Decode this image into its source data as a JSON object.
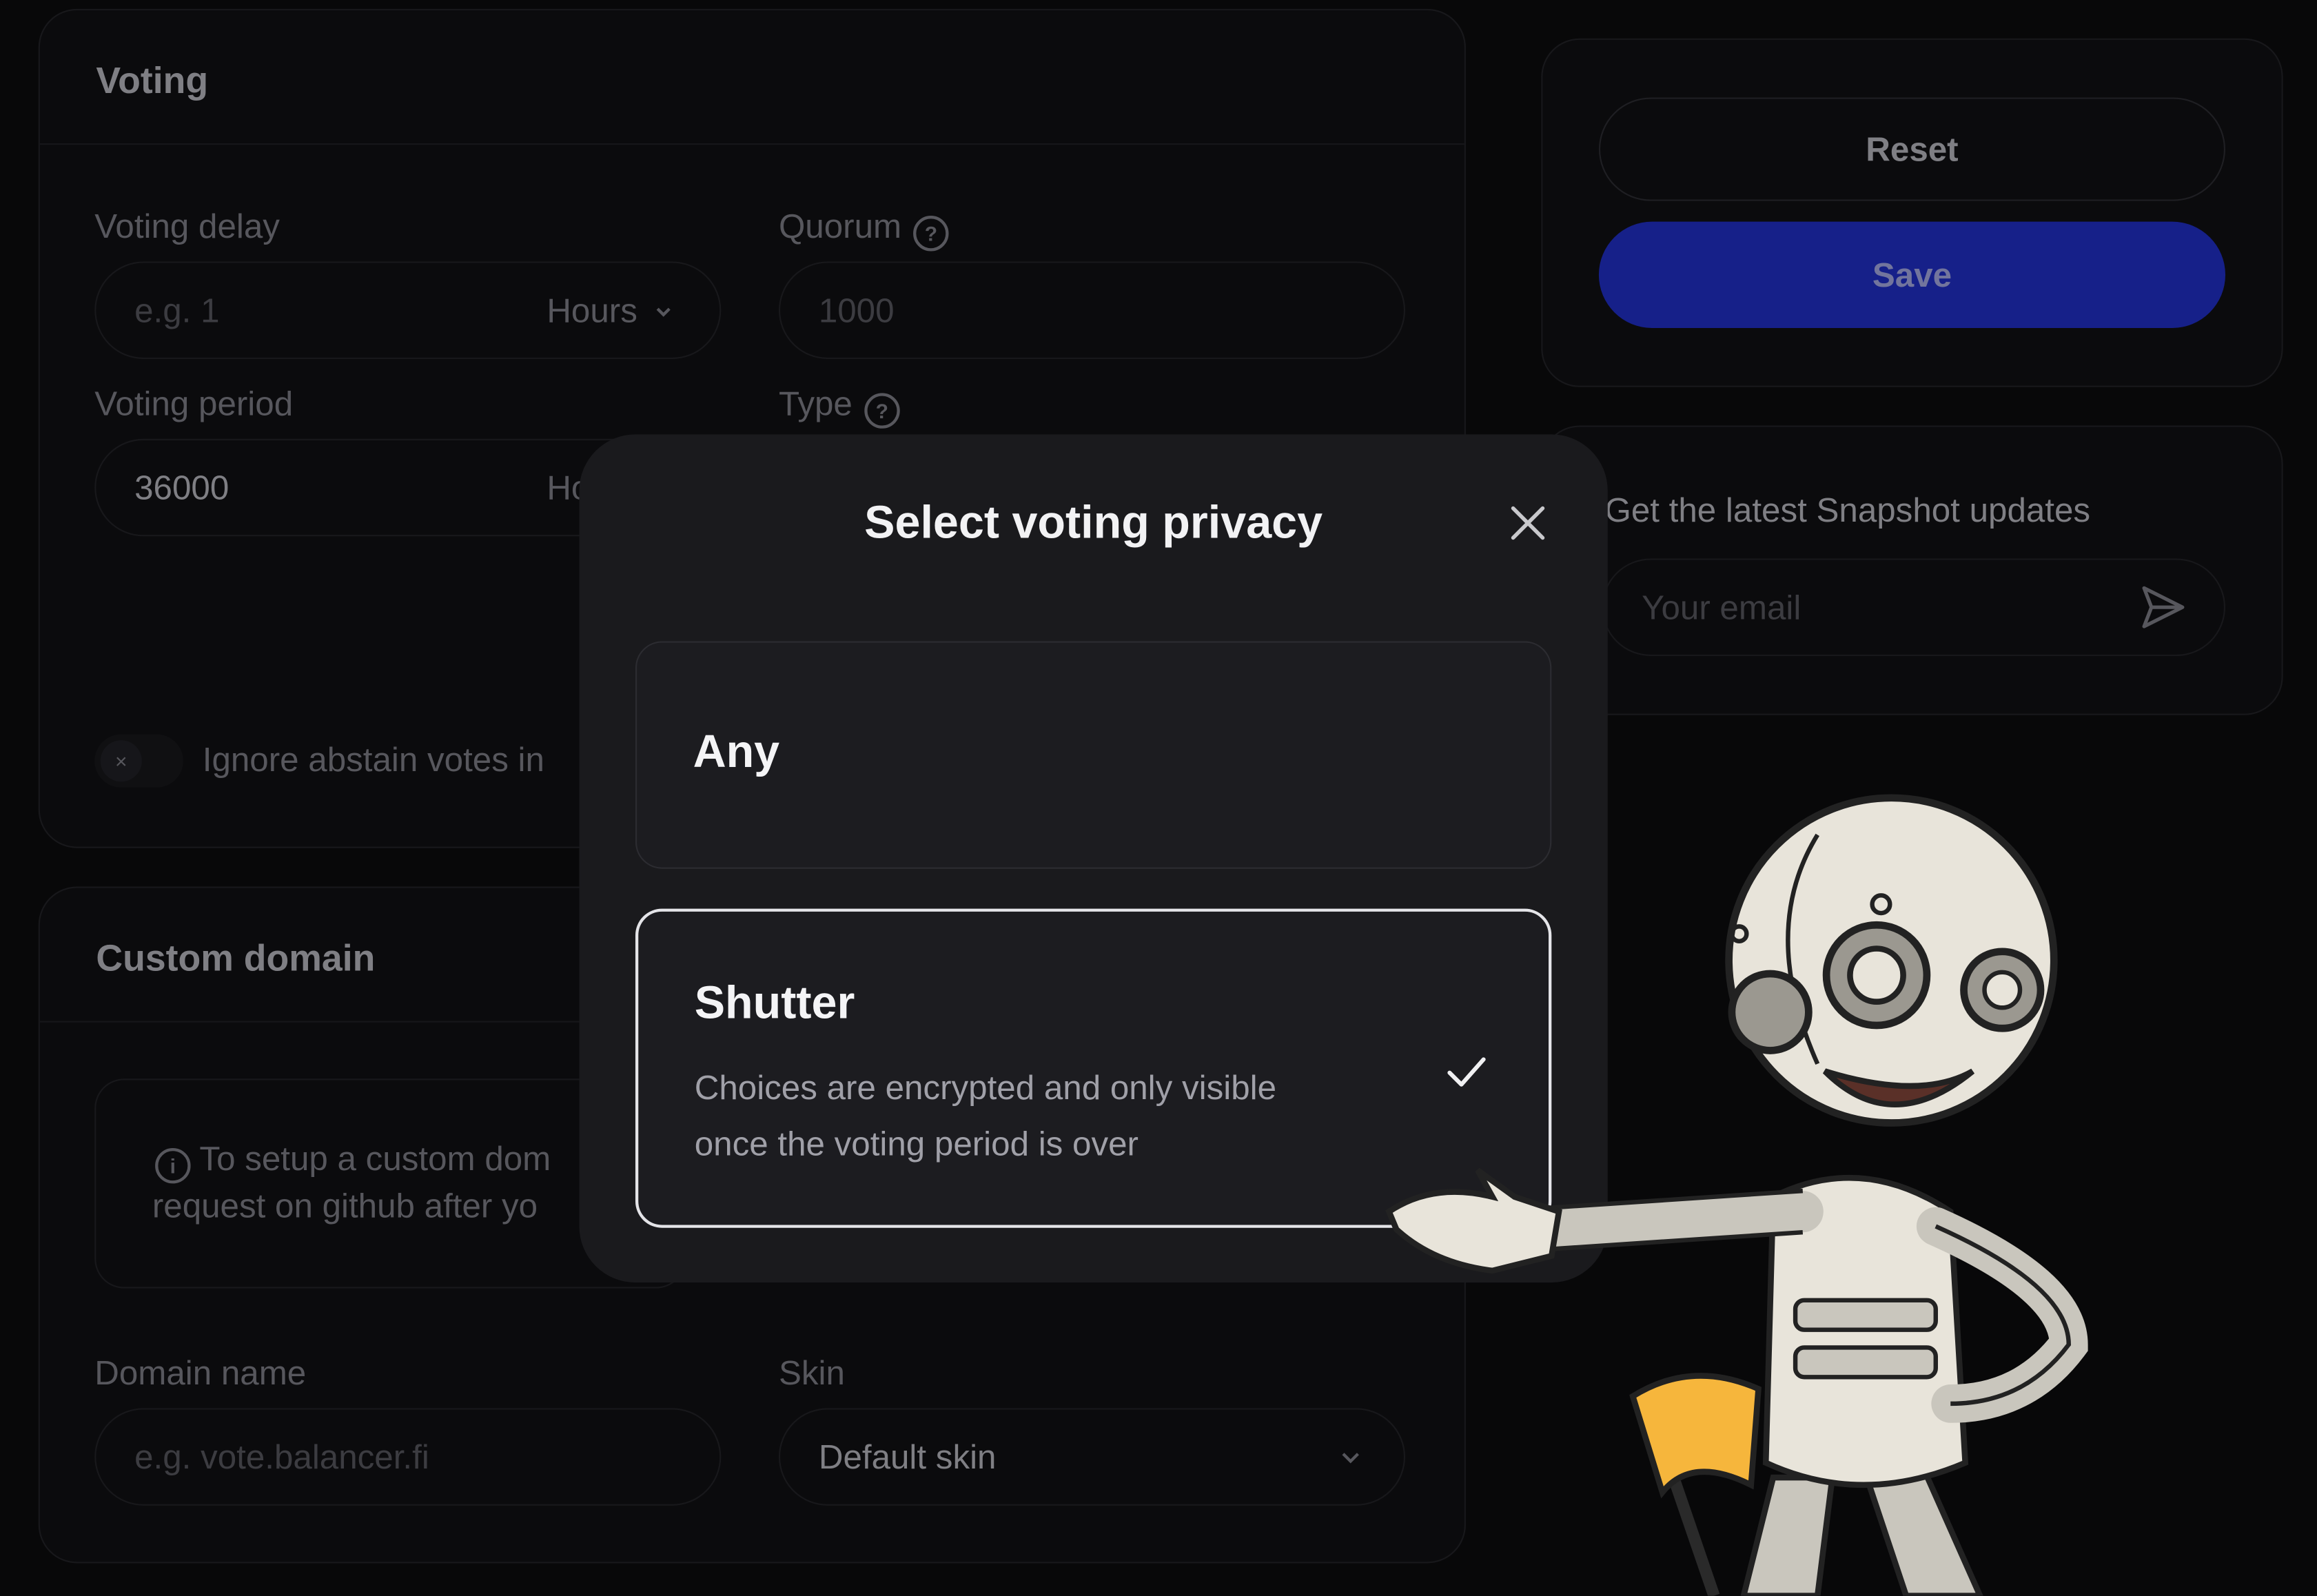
{
  "voting": {
    "title": "Voting",
    "voting_delay_label": "Voting delay",
    "voting_delay_placeholder": "e.g. 1",
    "voting_delay_unit": "Hours",
    "quorum_label": "Quorum",
    "quorum_value": "1000",
    "voting_period_label": "Voting period",
    "voting_period_value": "36000",
    "voting_period_unit": "Ho",
    "type_label": "Type",
    "ignore_abstain_label": "Ignore abstain votes in"
  },
  "custom_domain": {
    "title": "Custom domain",
    "info_line1": "To setup a custom dom",
    "info_line2": "request on github after yo",
    "domain_name_label": "Domain name",
    "domain_name_placeholder": "e.g. vote.balancer.fi",
    "skin_label": "Skin",
    "skin_value": "Default skin"
  },
  "actions": {
    "reset_label": "Reset",
    "save_label": "Save"
  },
  "newsletter": {
    "title": "Get the latest Snapshot updates",
    "email_placeholder": "Your email"
  },
  "modal": {
    "title": "Select voting privacy",
    "options": [
      {
        "title": "Any",
        "description": "",
        "selected": false
      },
      {
        "title": "Shutter",
        "description_line1": "Choices are encrypted and only visible",
        "description_line2": "once the voting period is over",
        "selected": true
      }
    ]
  },
  "colors": {
    "save_button": "#1c28a8",
    "modal_bg": "#1a1a1d",
    "mascot_flag": "#f6b63c"
  },
  "icons": [
    "question-icon",
    "chevron-down-icon",
    "x-icon",
    "info-icon",
    "send-icon",
    "close-icon",
    "checkmark-icon"
  ]
}
